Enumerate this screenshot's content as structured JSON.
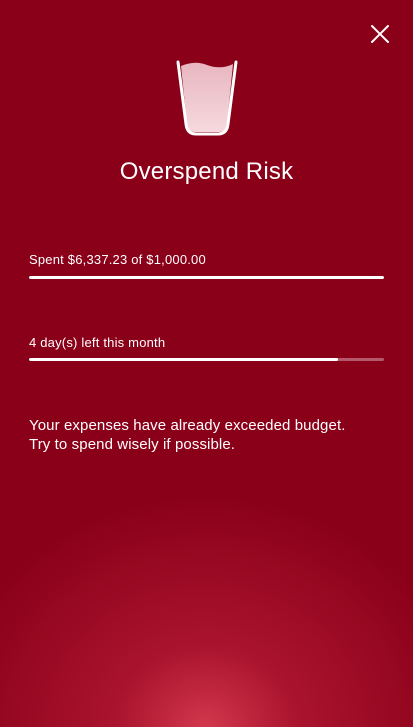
{
  "header": {
    "close_icon": "close-icon",
    "status_icon": "glass-icon",
    "title": "Overspend Risk"
  },
  "budget": {
    "label": "Spent $6,337.23 of $1,000.00",
    "progress_fraction": 1.0
  },
  "time": {
    "label": "4 day(s) left this month",
    "progress_fraction": 0.87
  },
  "message": {
    "line1": "Your expenses have already exceeded budget.",
    "line2": "Try to spend wisely if possible."
  },
  "colors": {
    "background": "#8b0019",
    "glow": "#d63a50",
    "text": "#ffffff"
  }
}
